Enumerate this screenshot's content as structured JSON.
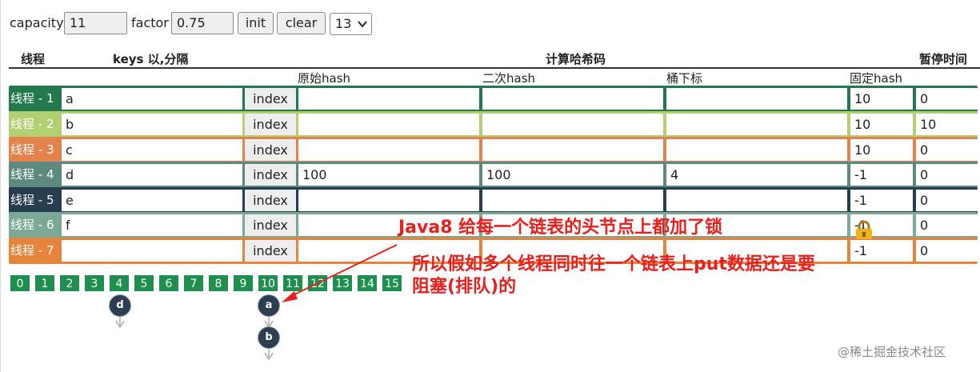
{
  "controls": {
    "capacity_label": "capacity",
    "capacity_value": "11",
    "factor_label": "factor",
    "factor_value": "0.75",
    "init_label": "init",
    "clear_label": "clear",
    "select_value": "13"
  },
  "headers": {
    "thread": "线程",
    "keys": "keys 以,分隔",
    "compute": "计算哈希码",
    "pause": "暂停时间",
    "original_hash": "原始hash",
    "second_hash": "二次hash",
    "bucket_index": "桶下标",
    "fixed_hash": "固定hash"
  },
  "rows": [
    {
      "thread": "线程 - 1",
      "key": "a",
      "button": "index",
      "orig": "",
      "second": "",
      "bucket": "",
      "fixed": "10",
      "pause": "0",
      "color": "#23794e",
      "bg": "#23794e"
    },
    {
      "thread": "线程 - 2",
      "key": "b",
      "button": "index",
      "orig": "",
      "second": "",
      "bucket": "",
      "fixed": "10",
      "pause": "10",
      "color": "#b2cf72",
      "bg": "#b2cf72"
    },
    {
      "thread": "线程 - 3",
      "key": "c",
      "button": "index",
      "orig": "",
      "second": "",
      "bucket": "",
      "fixed": "10",
      "pause": "0",
      "color": "#e3824a",
      "bg": "#e3824a"
    },
    {
      "thread": "线程 - 4",
      "key": "d",
      "button": "index",
      "orig": "100",
      "second": "100",
      "bucket": "4",
      "fixed": "-1",
      "pause": "0",
      "color": "#5d8a7e",
      "bg": "#5d8a7e"
    },
    {
      "thread": "线程 - 5",
      "key": "e",
      "button": "index",
      "orig": "",
      "second": "",
      "bucket": "",
      "fixed": "-1",
      "pause": "0",
      "color": "#283d4f",
      "bg": "#283d4f"
    },
    {
      "thread": "线程 - 6",
      "key": "f",
      "button": "index",
      "orig": "",
      "second": "",
      "bucket": "",
      "fixed": "-1",
      "pause": "0",
      "color": "#7aaa96",
      "bg": "#7aaa96"
    },
    {
      "thread": "线程 - 7",
      "key": "",
      "button": "index",
      "orig": "",
      "second": "",
      "bucket": "",
      "fixed": "-1",
      "pause": "0",
      "color": "#e6843e",
      "bg": "#e6843e"
    }
  ],
  "buckets": [
    "0",
    "1",
    "2",
    "3",
    "4",
    "5",
    "6",
    "7",
    "8",
    "9",
    "10",
    "11",
    "12",
    "13",
    "14",
    "15"
  ],
  "nodes": {
    "d": "d",
    "a": "a",
    "b": "b"
  },
  "annotation": {
    "line1": "Java8 给每一个链表的头节点上都加了锁",
    "line2": "所以假如多个线程同时往一个链表上put数据还是要",
    "line3": "阻塞(排队)的",
    "lock_icon": "lock-icon"
  },
  "watermark": "@稀土掘金技术社区",
  "colors": {
    "bucket": "#1f8f4f",
    "annotation": "#e8201c",
    "node": "#2c3e50"
  }
}
